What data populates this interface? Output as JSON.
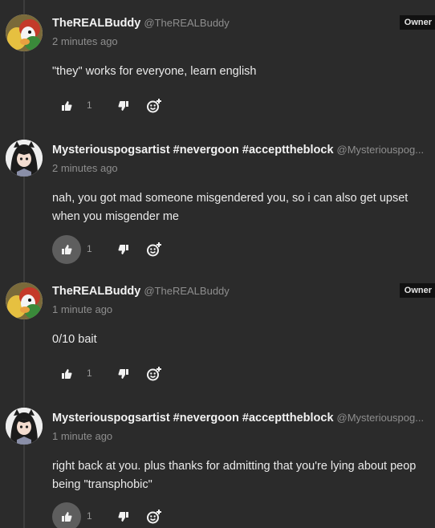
{
  "colors": {
    "background": "#2b2b2b",
    "owner_badge_bg": "#111111",
    "muted_text": "#8e8e8e",
    "active_like_bg": "#5e5e5e"
  },
  "comments": [
    {
      "author": "TheREALBuddy",
      "handle": "@TheREALBuddy",
      "badge": "Owner",
      "time": "2 minutes ago",
      "lines": [
        "\"they\" works for everyone, learn english"
      ],
      "likes": "1",
      "like_active": false,
      "avatar": "duck-avatar"
    },
    {
      "author": "Mysteriouspogsartist #nevergoon #accepttheblock",
      "handle": "@Mysteriouspog...",
      "badge": "",
      "time": "2 minutes ago",
      "lines": [
        "nah, you got mad someone misgendered you, so i can also get upset",
        "when you misgender me"
      ],
      "likes": "1",
      "like_active": true,
      "avatar": "anime-girl-avatar"
    },
    {
      "author": "TheREALBuddy",
      "handle": "@TheREALBuddy",
      "badge": "Owner",
      "time": "1 minute ago",
      "lines": [
        "0/10 bait"
      ],
      "likes": "1",
      "like_active": false,
      "avatar": "duck-avatar"
    },
    {
      "author": "Mysteriouspogsartist #nevergoon #accepttheblock",
      "handle": "@Mysteriouspog...",
      "badge": "",
      "time": "1 minute ago",
      "lines": [
        "right back at you. plus thanks for admitting that you're lying about peop",
        "being \"transphobic\""
      ],
      "likes": "1",
      "like_active": true,
      "avatar": "anime-girl-avatar"
    }
  ]
}
